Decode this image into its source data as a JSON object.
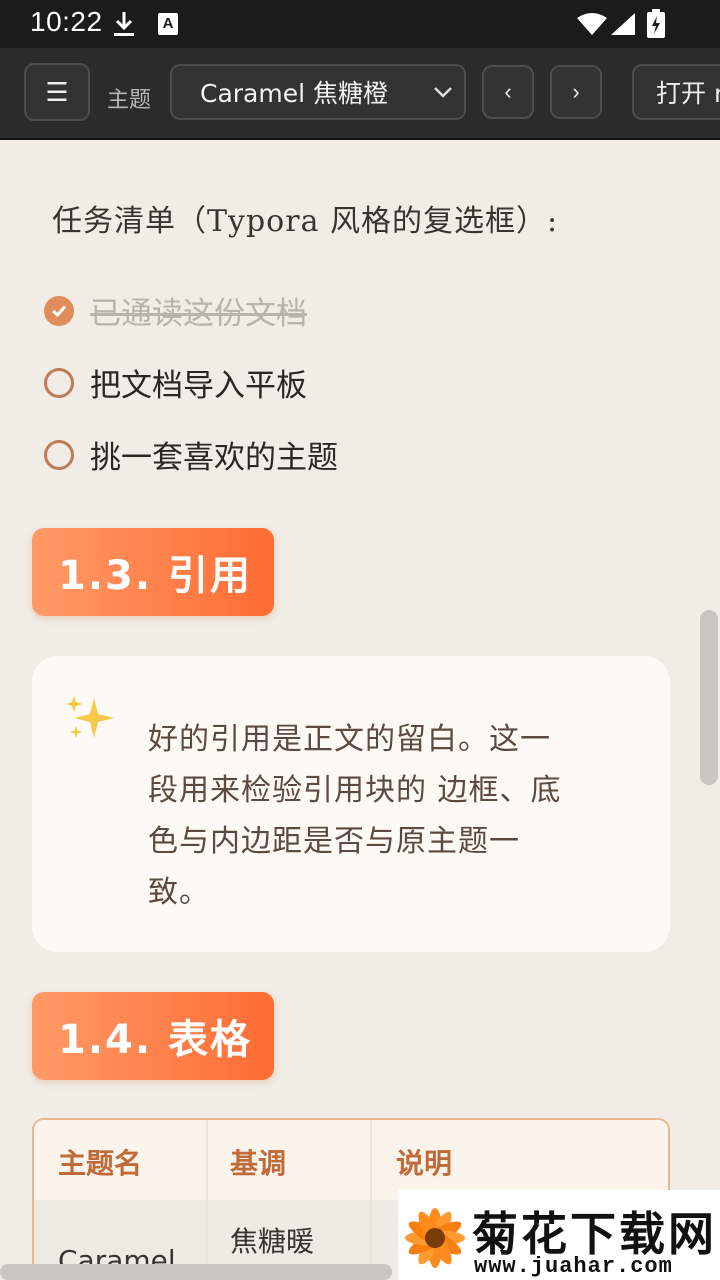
{
  "status_bar": {
    "time": "10:22",
    "a_badge": "A"
  },
  "toolbar": {
    "menu_glyph": "☰",
    "theme_label": "主题",
    "theme_selected": "Caramel 焦糖橙",
    "prev_glyph": "‹",
    "next_glyph": "›",
    "open_label": "打开 m"
  },
  "task_list": {
    "title": "任务清单（Typora 风格的复选框）:",
    "items": [
      {
        "label": "已通读这份文档",
        "checked": true
      },
      {
        "label": "把文档导入平板",
        "checked": false
      },
      {
        "label": "挑一套喜欢的主题",
        "checked": false
      }
    ]
  },
  "sections": {
    "quote_heading": "1.3. 引用",
    "table_heading": "1.4. 表格"
  },
  "quote": {
    "icon": "sparkles-icon",
    "lines": [
      "好的引用是正文的留白。这一",
      "段用来检验引用块的 边框、底",
      "色与内边距是否与原主题一",
      "致。"
    ]
  },
  "table": {
    "headers": [
      "主题名",
      "基调",
      "说明"
    ],
    "rows": [
      {
        "name": "Caramel",
        "tone": "焦糖暖",
        "desc": ""
      }
    ]
  },
  "watermark": {
    "title": "菊花下载网",
    "url": "www.juahar.com"
  },
  "colors": {
    "accent": "#ff7a3d",
    "checkbox": "#e08d5b",
    "table_header_text": "#c06a3a"
  }
}
